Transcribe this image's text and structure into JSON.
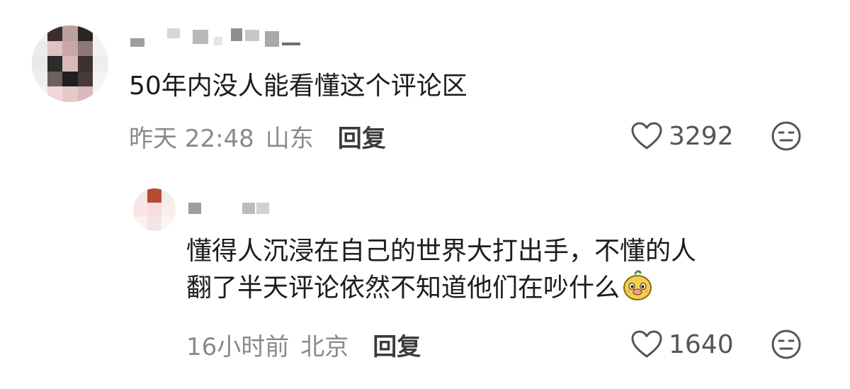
{
  "comments": [
    {
      "text": "50年内没人能看懂这个评论区",
      "time": "昨天 22:48",
      "location": "山东",
      "reply_label": "回复",
      "likes": "3292"
    }
  ],
  "replies": [
    {
      "text_line1": "懂得人沉浸在自己的世界大打出手，不懂的人",
      "text_line2": "翻了半天评论依然不知道他们在吵什么",
      "time": "16小时前",
      "location": "北京",
      "reply_label": "回复",
      "likes": "1640"
    }
  ],
  "colors": {
    "meta_text": "#8a8a8a",
    "body_text": "#1c1c1c",
    "icon_stroke": "#555555"
  },
  "icons": {
    "like": "heart-outline-icon",
    "dislike": "meh-face-icon",
    "sticker": "cartoon-mascot-emoji"
  }
}
